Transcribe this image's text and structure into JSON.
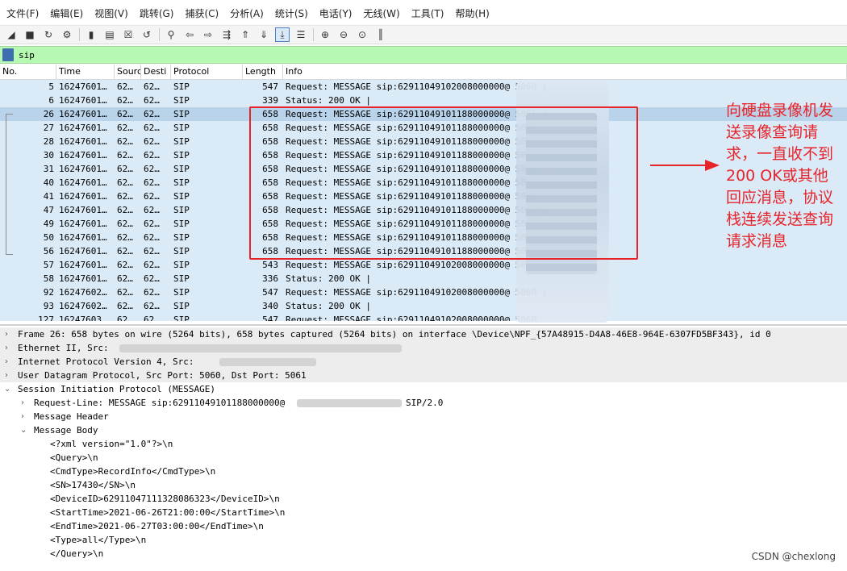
{
  "menu": [
    "文件(F)",
    "编辑(E)",
    "视图(V)",
    "跳转(G)",
    "捕获(C)",
    "分析(A)",
    "统计(S)",
    "电话(Y)",
    "无线(W)",
    "工具(T)",
    "帮助(H)"
  ],
  "toolbar_icons": [
    "shark-fin-start-icon",
    "stop-capture-icon",
    "restart-capture-icon",
    "capture-options-icon",
    "open-file-icon",
    "save-file-icon",
    "close-file-icon",
    "reload-file-icon",
    "find-packet-icon",
    "go-back-icon",
    "go-forward-icon",
    "go-to-packet-icon",
    "go-first-icon",
    "go-last-icon",
    "autoscroll-icon",
    "colorize-icon",
    "zoom-in-icon",
    "zoom-out-icon",
    "zoom-normal-icon",
    "resize-columns-icon"
  ],
  "filter": {
    "value": "sip"
  },
  "columns": [
    "No.",
    "Time",
    "Sourc",
    "Desti",
    "Protocol",
    "Length",
    "Info"
  ],
  "packets": [
    {
      "no": "5",
      "time": "16247601…",
      "src": "62…",
      "dst": "62…",
      "proto": "SIP",
      "len": "547",
      "info": "Request: MESSAGE sip:62911049102008000000@                5060 |",
      "selected": false
    },
    {
      "no": "6",
      "time": "16247601…",
      "src": "62…",
      "dst": "62…",
      "proto": "SIP",
      "len": "339",
      "info": "Status: 200 OK |",
      "selected": false
    },
    {
      "no": "26",
      "time": "16247601…",
      "src": "62…",
      "dst": "62…",
      "proto": "SIP",
      "len": "658",
      "info": "Request: MESSAGE sip:62911049101188000000@                5061 |",
      "selected": true
    },
    {
      "no": "27",
      "time": "16247601…",
      "src": "62…",
      "dst": "62…",
      "proto": "SIP",
      "len": "658",
      "info": "Request: MESSAGE sip:62911049101188000000@                5061 |",
      "selected": false
    },
    {
      "no": "28",
      "time": "16247601…",
      "src": "62…",
      "dst": "62…",
      "proto": "SIP",
      "len": "658",
      "info": "Request: MESSAGE sip:62911049101188000000@                5061 |",
      "selected": false
    },
    {
      "no": "30",
      "time": "16247601…",
      "src": "62…",
      "dst": "62…",
      "proto": "SIP",
      "len": "658",
      "info": "Request: MESSAGE sip:62911049101188000000@                5061 |",
      "selected": false
    },
    {
      "no": "31",
      "time": "16247601…",
      "src": "62…",
      "dst": "62…",
      "proto": "SIP",
      "len": "658",
      "info": "Request: MESSAGE sip:62911049101188000000@                5061 |",
      "selected": false
    },
    {
      "no": "40",
      "time": "16247601…",
      "src": "62…",
      "dst": "62…",
      "proto": "SIP",
      "len": "658",
      "info": "Request: MESSAGE sip:62911049101188000000@                5061 |",
      "selected": false
    },
    {
      "no": "41",
      "time": "16247601…",
      "src": "62…",
      "dst": "62…",
      "proto": "SIP",
      "len": "658",
      "info": "Request: MESSAGE sip:62911049101188000000@                5061 |",
      "selected": false
    },
    {
      "no": "47",
      "time": "16247601…",
      "src": "62…",
      "dst": "62…",
      "proto": "SIP",
      "len": "658",
      "info": "Request: MESSAGE sip:62911049101188000000@                5061 |",
      "selected": false
    },
    {
      "no": "49",
      "time": "16247601…",
      "src": "62…",
      "dst": "62…",
      "proto": "SIP",
      "len": "658",
      "info": "Request: MESSAGE sip:62911049101188000000@                5061 |",
      "selected": false
    },
    {
      "no": "50",
      "time": "16247601…",
      "src": "62…",
      "dst": "62…",
      "proto": "SIP",
      "len": "658",
      "info": "Request: MESSAGE sip:62911049101188000000@                5061 |",
      "selected": false
    },
    {
      "no": "56",
      "time": "16247601…",
      "src": "62…",
      "dst": "62…",
      "proto": "SIP",
      "len": "658",
      "info": "Request: MESSAGE sip:62911049101188000000@                5061 |",
      "selected": false
    },
    {
      "no": "57",
      "time": "16247601…",
      "src": "62…",
      "dst": "62…",
      "proto": "SIP",
      "len": "543",
      "info": "Request: MESSAGE sip:62911049102008000000@                5060",
      "selected": false
    },
    {
      "no": "58",
      "time": "16247601…",
      "src": "62…",
      "dst": "62…",
      "proto": "SIP",
      "len": "336",
      "info": "Status: 200 OK |",
      "selected": false
    },
    {
      "no": "92",
      "time": "16247602…",
      "src": "62…",
      "dst": "62…",
      "proto": "SIP",
      "len": "547",
      "info": "Request: MESSAGE sip:62911049102008000000@                5060 |",
      "selected": false
    },
    {
      "no": "93",
      "time": "16247602…",
      "src": "62…",
      "dst": "62…",
      "proto": "SIP",
      "len": "340",
      "info": "Status: 200 OK |",
      "selected": false
    },
    {
      "no": "127",
      "time": "16247603…",
      "src": "62…",
      "dst": "62…",
      "proto": "SIP",
      "len": "547",
      "info": "Request: MESSAGE sip:62911049102008000000@                5060",
      "selected": false
    }
  ],
  "annotation": "向硬盘录像机发送录像查询请求，一直收不到200 OK或其他回应消息，协议栈连续发送查询请求消息",
  "details": {
    "frame": "Frame 26: 658 bytes on wire (5264 bits), 658 bytes captured (5264 bits) on interface \\Device\\NPF_{57A48915-D4A8-46E8-964E-6307FD5BF343}, id 0",
    "ethernet": "Ethernet II, Src:",
    "ip": "Internet Protocol Version 4, Src:",
    "udp": "User Datagram Protocol, Src Port: 5060, Dst Port: 5061",
    "sip": "Session Initiation Protocol (MESSAGE)",
    "request_line_a": "Request-Line: MESSAGE sip:62911049101188000000@",
    "request_line_b": "SIP/2.0",
    "message_header": "Message Header",
    "message_body": "Message Body",
    "body_lines": [
      "<?xml version=\"1.0\"?>\\n",
      "<Query>\\n",
      "<CmdType>RecordInfo</CmdType>\\n",
      "<SN>17430</SN>\\n",
      "<DeviceID>62911047111328086323</DeviceID>\\n",
      "<StartTime>2021-06-26T21:00:00</StartTime>\\n",
      "<EndTime>2021-06-27T03:00:00</EndTime>\\n",
      "<Type>all</Type>\\n",
      "</Query>\\n"
    ]
  },
  "watermark": "CSDN @chexlong"
}
